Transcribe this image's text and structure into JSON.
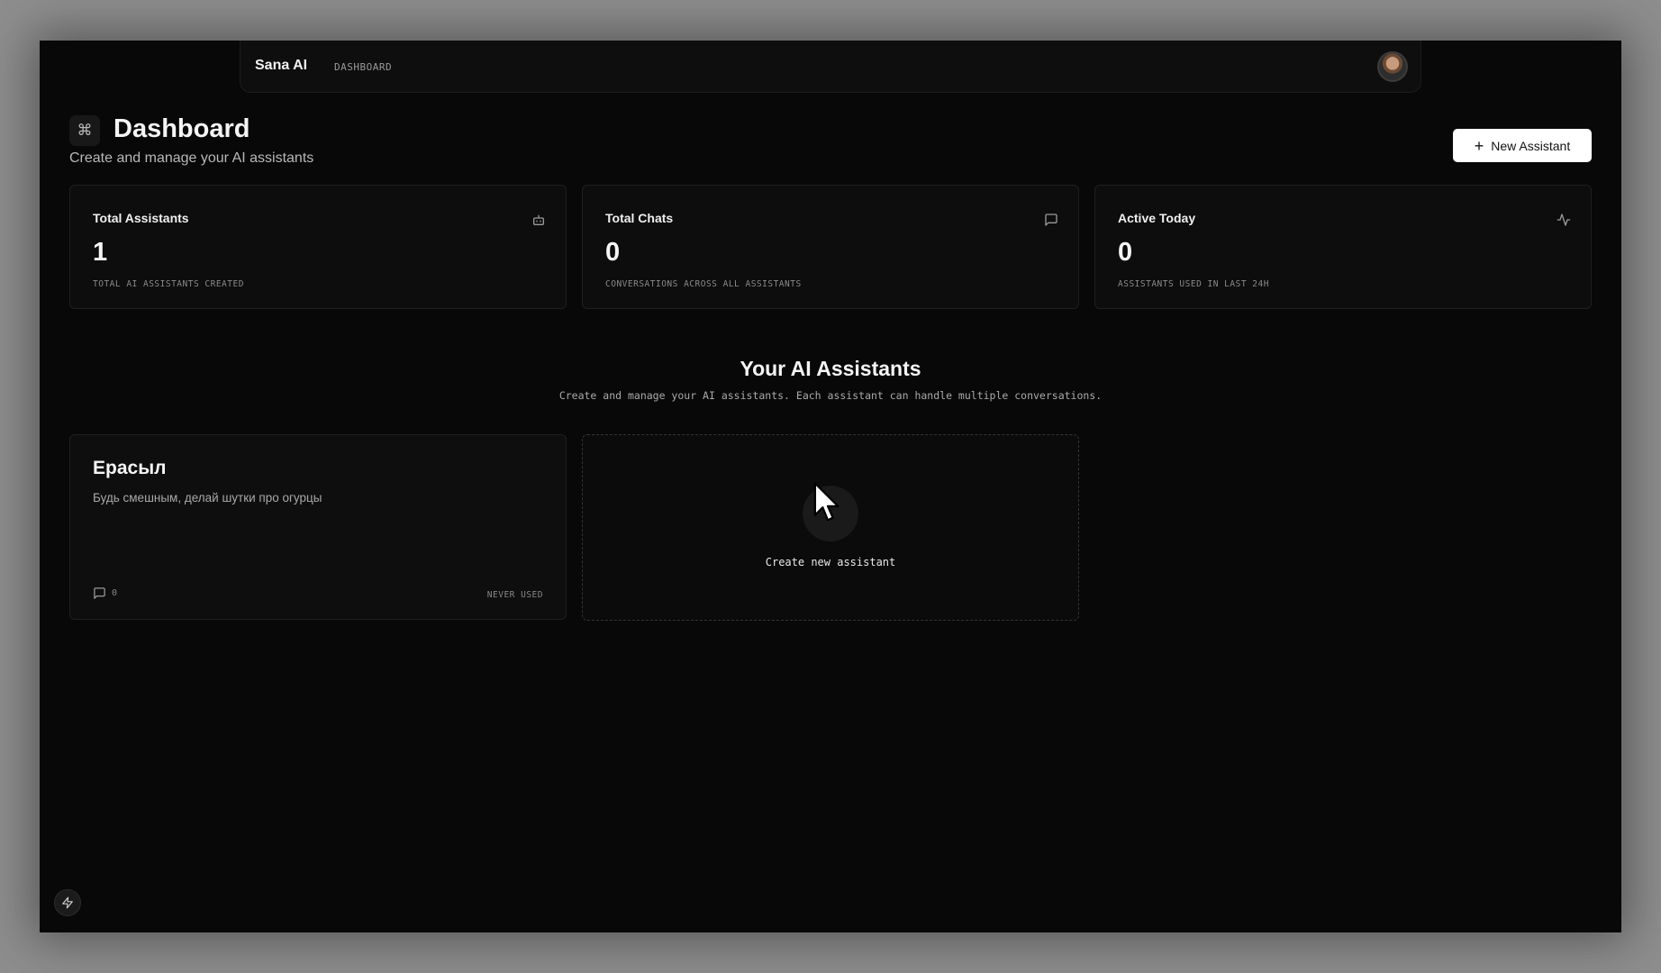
{
  "nav": {
    "brand": "Sana AI",
    "breadcrumb": "DASHBOARD"
  },
  "header": {
    "icon": "command-icon",
    "icon_glyph": "⌘",
    "title": "Dashboard",
    "subtitle": "Create and manage your AI assistants",
    "new_button_label": "New Assistant"
  },
  "stats": [
    {
      "title": "Total Assistants",
      "value": "1",
      "description": "TOTAL AI ASSISTANTS CREATED",
      "icon": "bot-icon"
    },
    {
      "title": "Total Chats",
      "value": "0",
      "description": "CONVERSATIONS ACROSS ALL ASSISTANTS",
      "icon": "message-square-icon"
    },
    {
      "title": "Active Today",
      "value": "0",
      "description": "ASSISTANTS USED IN LAST 24H",
      "icon": "activity-icon"
    }
  ],
  "section": {
    "title": "Your AI Assistants",
    "subtitle": "Create and manage your AI assistants. Each assistant can handle multiple conversations."
  },
  "assistants": [
    {
      "name": "Ерасыл",
      "description": "Будь смешным, делай шутки про огурцы",
      "chat_count": "0",
      "last_used": "NEVER USED"
    }
  ],
  "create_card": {
    "label": "Create new assistant"
  },
  "colors": {
    "background": "#080808",
    "card": "#0d0d0d",
    "border": "#1f1f1f",
    "primary_button": "#ffffff"
  }
}
